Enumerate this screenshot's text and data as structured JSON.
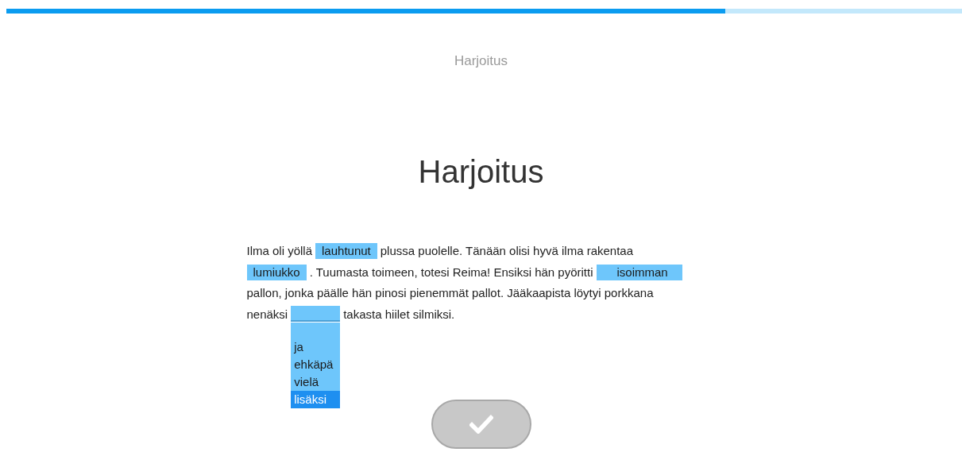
{
  "progress": {
    "level": 0.752
  },
  "header": "Harjoitus",
  "title": "Harjoitus",
  "passage": [
    [
      {
        "kind": "text",
        "text": "Ilma oli yöllä"
      },
      {
        "kind": "blank",
        "value": "lauhtunut",
        "open": false
      },
      {
        "kind": "text",
        "text": "plussa puolelle. Tänään olisi hyvä ilma rakentaa"
      }
    ],
    [
      {
        "kind": "blank",
        "value": "lumiukko",
        "open": false
      },
      {
        "kind": "text",
        "text": ". Tuumasta toimeen, totesi Reima! Ensiksi hän pyöritti"
      },
      {
        "kind": "blank",
        "value": "isoimman",
        "open": false,
        "wide": true
      }
    ],
    [
      {
        "kind": "text",
        "text": "pallon, jonka päälle hän pinosi pienemmät pallot. Jääkaapista löytyi porkkana"
      }
    ],
    [
      {
        "kind": "text",
        "text": "nenäksi"
      },
      {
        "kind": "blank",
        "open": true,
        "options": [
          {
            "label": "ja",
            "selected": false
          },
          {
            "label": "ehkäpä",
            "selected": false
          },
          {
            "label": "vielä",
            "selected": false
          },
          {
            "label": "lisäksi",
            "selected": true
          }
        ]
      },
      {
        "kind": "text",
        "text": "takasta hiilet silmiksi."
      }
    ]
  ],
  "submit": {
    "disabled": true
  }
}
